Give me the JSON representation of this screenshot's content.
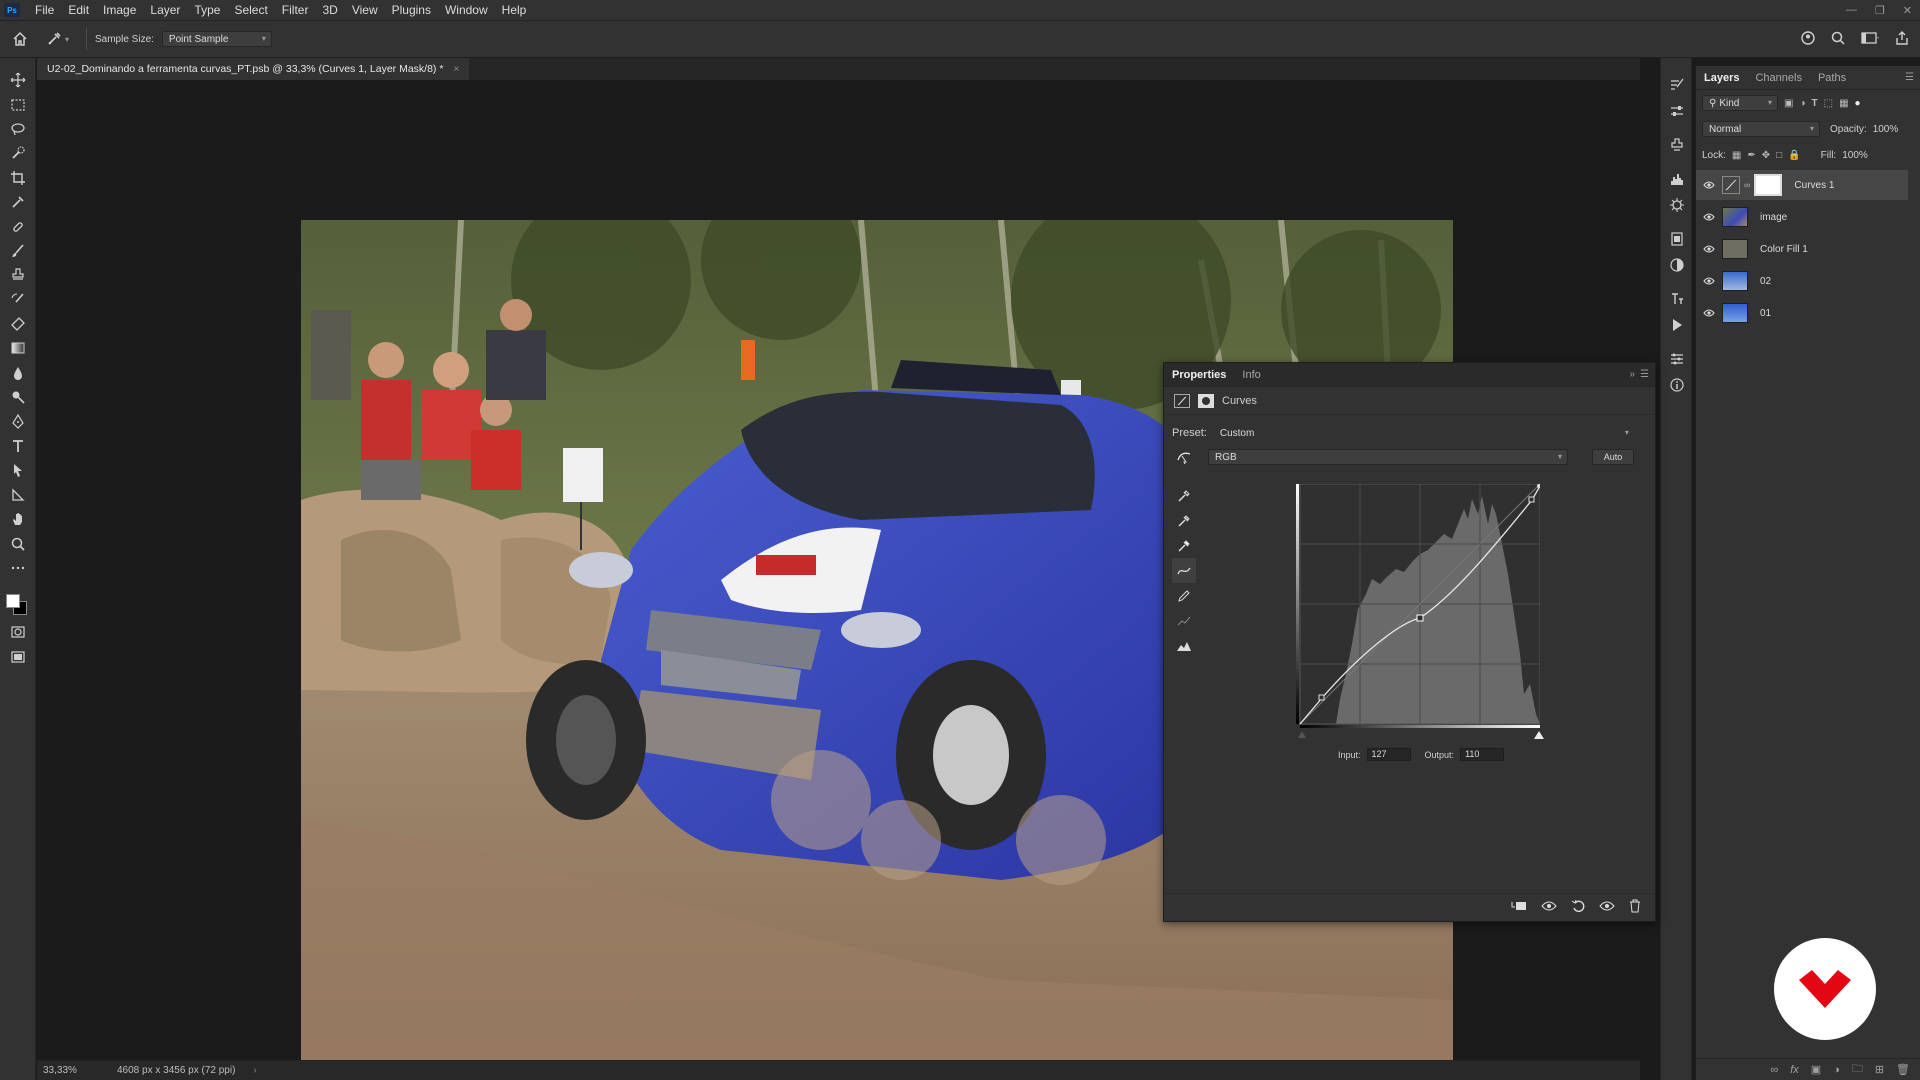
{
  "menubar": {
    "app_logo": "Ps",
    "items": [
      "File",
      "Edit",
      "Image",
      "Layer",
      "Type",
      "Select",
      "Filter",
      "3D",
      "View",
      "Plugins",
      "Window",
      "Help"
    ]
  },
  "options": {
    "sample_size_label": "Sample Size:",
    "sample_size_value": "Point Sample"
  },
  "document": {
    "tab_title": "U2-02_Dominando a ferramenta curvas_PT.psb @ 33,3% (Curves 1, Layer Mask/8) *",
    "close": "×"
  },
  "status": {
    "zoom": "33,33%",
    "doc_info": "4608 px x 3456 px (72 ppi)",
    "arrow": "›"
  },
  "layers_panel": {
    "tabs": [
      "Layers",
      "Channels",
      "Paths"
    ],
    "filter_kind": "Kind",
    "blend_mode": "Normal",
    "opacity_label": "Opacity:",
    "opacity_value": "100%",
    "lock_label": "Lock:",
    "fill_label": "Fill:",
    "fill_value": "100%",
    "layers": [
      {
        "name": "Curves 1",
        "selected": true
      },
      {
        "name": "image",
        "selected": false
      },
      {
        "name": "Color Fill 1",
        "selected": false
      },
      {
        "name": "02",
        "selected": false
      },
      {
        "name": "01",
        "selected": false
      }
    ]
  },
  "properties_panel": {
    "tabs": [
      "Properties",
      "Info"
    ],
    "adjustment_name": "Curves",
    "preset_label": "Preset:",
    "preset_value": "Custom",
    "channel_value": "RGB",
    "auto_label": "Auto",
    "input_label": "Input:",
    "input_value": "127",
    "output_label": "Output:",
    "output_value": "110"
  },
  "colors": {
    "panel_bg": "#323232",
    "canvas_bg": "#1b1b1b",
    "badge_red": "#e30613",
    "foreground": "#ffffff",
    "background": "#000000"
  }
}
